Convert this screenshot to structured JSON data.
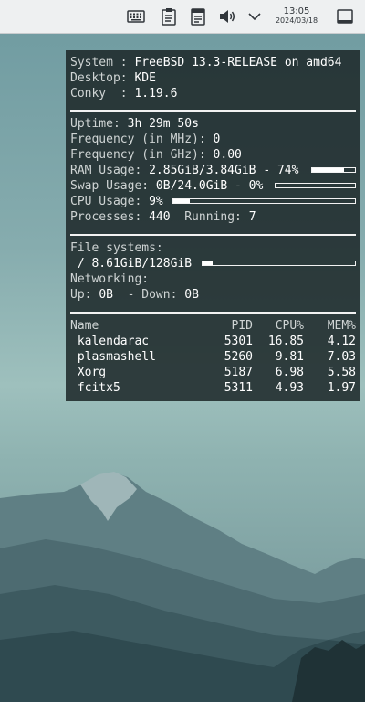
{
  "panel": {
    "icons": [
      "keyboard-icon",
      "clipboard-icon",
      "notes-icon",
      "volume-icon",
      "chevron-down-icon",
      "show-desktop-icon"
    ],
    "clock": {
      "time": "13:05",
      "date": "2024/03/18"
    }
  },
  "conky": {
    "system": {
      "label": "System : ",
      "value": "FreeBSD 13.3-RELEASE on amd64"
    },
    "desktop": {
      "label": "Desktop: ",
      "value": "KDE"
    },
    "conky": {
      "label": "Conky  : ",
      "value": "1.19.6"
    },
    "uptime": {
      "label": "Uptime: ",
      "value": "3h 29m 50s"
    },
    "freq_mhz": {
      "label": "Frequency (in MHz): ",
      "value": "0"
    },
    "freq_ghz": {
      "label": "Frequency (in GHz): ",
      "value": "0.00"
    },
    "ram": {
      "label": "RAM Usage: ",
      "value": "2.85GiB/3.84GiB - 74%",
      "fraction": 0.74
    },
    "swap": {
      "label": "Swap Usage: ",
      "value": "0B/24.0GiB - 0%",
      "fraction": 0.0
    },
    "cpu": {
      "label": "CPU Usage: ",
      "value": "9%",
      "fraction": 0.09
    },
    "processes": {
      "label": "Processes: ",
      "value": "440",
      "running_label": "Running: ",
      "running_value": "7"
    },
    "filesystems": {
      "label": "File systems:",
      "root": " / 8.61GiB/128GiB",
      "fraction": 0.067
    },
    "networking": {
      "label": "Networking:",
      "up_label": "Up: ",
      "up_value": "0B",
      "down_label": "  - Down: ",
      "down_value": "0B"
    },
    "table": {
      "headers": [
        "Name",
        "PID",
        "CPU%",
        "MEM%"
      ],
      "rows": [
        [
          " kalendarac",
          "5301",
          "16.85",
          "4.12"
        ],
        [
          " plasmashell",
          "5260",
          "9.81",
          "7.03"
        ],
        [
          " Xorg",
          "5187",
          "6.98",
          "5.58"
        ],
        [
          " fcitx5",
          "5311",
          "4.93",
          "1.97"
        ]
      ]
    }
  }
}
